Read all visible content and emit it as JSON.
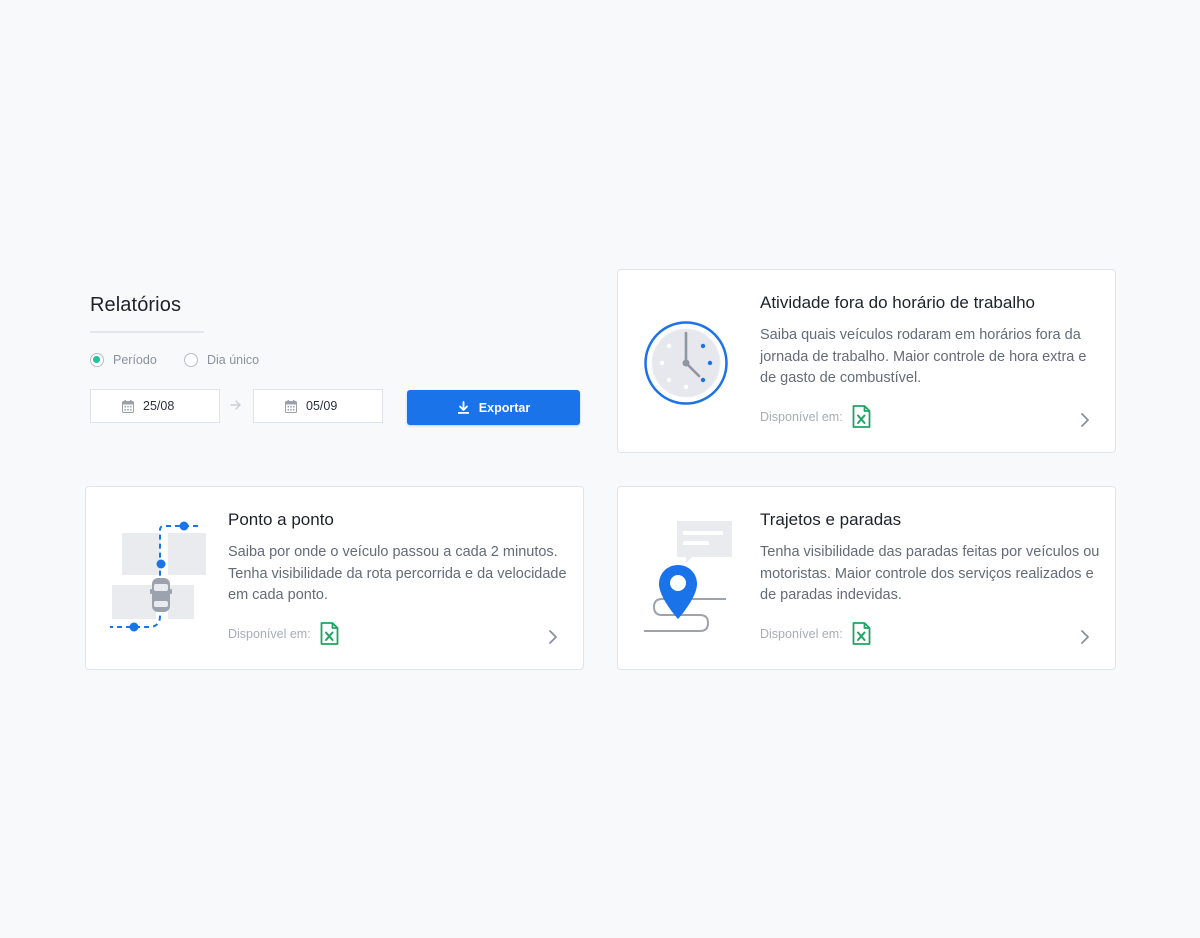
{
  "panel": {
    "title": "Relatórios",
    "radios": [
      {
        "label": "Período",
        "checked": true
      },
      {
        "label": "Dia único",
        "checked": false
      }
    ],
    "date_start": "25/08",
    "date_end": "05/09",
    "export_label": "Exportar"
  },
  "colors": {
    "primary": "#1a73e8",
    "radio_selected": "#1fc29a",
    "excel_green": "#1fa463",
    "page_bg": "#f8f9fb"
  },
  "cards": [
    {
      "title": "Atividade fora do horário de trabalho",
      "description": "Saiba quais veículos rodaram em horários fora da jornada de trabalho. Maior controle de hora extra e de gasto de combustível.",
      "available_label": "Disponível em:"
    },
    {
      "title": "Ponto a ponto",
      "description": "Saiba por onde o veículo passou a cada 2 minutos. Tenha visibilidade da rota percorrida e da velocidade em cada ponto.",
      "available_label": "Disponível em:"
    },
    {
      "title": "Trajetos e paradas",
      "description": "Tenha visibilidade das paradas feitas por veículos ou motoristas. Maior controle dos serviços realizados e de paradas indevidas.",
      "available_label": "Disponível em:"
    }
  ],
  "icons": {
    "calendar": "calendar-icon",
    "arrow": "arrow-right-icon",
    "download": "download-icon",
    "excel": "excel-file-icon",
    "chevron": "chevron-right-icon"
  }
}
